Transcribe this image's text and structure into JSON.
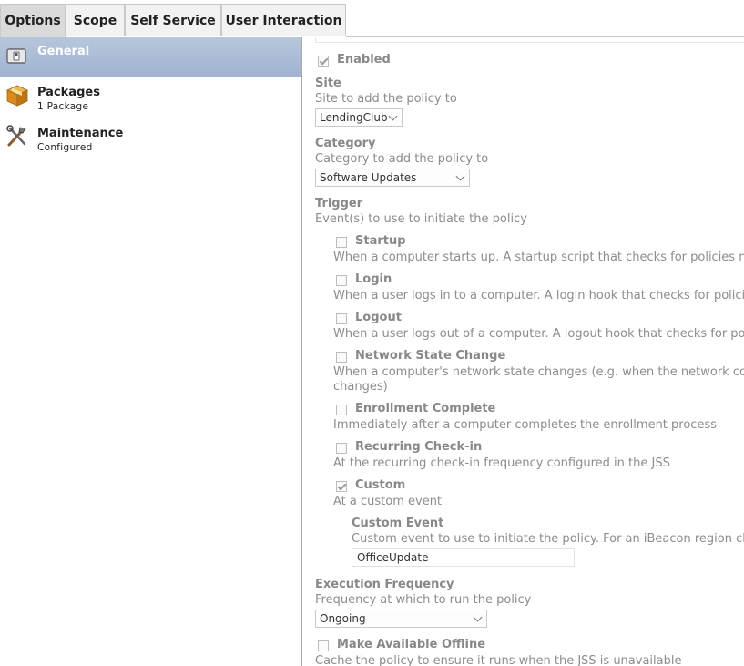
{
  "tabs": [
    {
      "label": "Options",
      "active": true
    },
    {
      "label": "Scope"
    },
    {
      "label": "Self Service"
    },
    {
      "label": "User Interaction"
    }
  ],
  "sidebar": {
    "items": [
      {
        "title": "General",
        "icon": "switch-icon",
        "active": true
      },
      {
        "title": "Packages",
        "subtitle": "1 Package",
        "icon": "package-box-icon"
      },
      {
        "title": "Maintenance",
        "subtitle": "Configured",
        "icon": "tools-icon"
      }
    ]
  },
  "general": {
    "enabled_label": "Enabled",
    "enabled_checked": true,
    "site": {
      "label": "Site",
      "desc": "Site to add the policy to",
      "value": "LendingClub"
    },
    "category": {
      "label": "Category",
      "desc": "Category to add the policy to",
      "value": "Software Updates"
    },
    "trigger": {
      "label": "Trigger",
      "desc": "Event(s) to use to initiate the policy",
      "items": [
        {
          "label": "Startup",
          "checked": false,
          "desc": "When a computer starts up. A startup script that checks for policies mus"
        },
        {
          "label": "Login",
          "checked": false,
          "desc": "When a user logs in to a computer. A login hook that checks for policies"
        },
        {
          "label": "Logout",
          "checked": false,
          "desc": "When a user logs out of a computer. A logout hook that checks for polici"
        },
        {
          "label": "Network State Change",
          "checked": false,
          "desc": "When a computer's network state changes (e.g. when the network con",
          "desc2": "changes)"
        },
        {
          "label": "Enrollment Complete",
          "checked": false,
          "desc": "Immediately after a computer completes the enrollment process"
        },
        {
          "label": "Recurring Check-in",
          "checked": false,
          "desc": "At the recurring check-in frequency configured in the JSS"
        },
        {
          "label": "Custom",
          "checked": true,
          "desc": "At a custom event"
        }
      ],
      "custom_event": {
        "label": "Custom Event",
        "desc": "Custom event to use to initiate the policy. For an iBeacon region cha",
        "value": "OfficeUpdate"
      }
    },
    "execution_frequency": {
      "label": "Execution Frequency",
      "desc": "Frequency at which to run the policy",
      "value": "Ongoing"
    },
    "offline": {
      "label": "Make Available Offline",
      "checked": false,
      "desc": "Cache the policy to ensure it runs when the JSS is unavailable"
    }
  }
}
